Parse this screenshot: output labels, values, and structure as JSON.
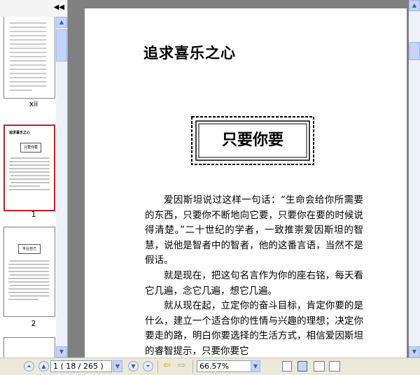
{
  "sidebar": {
    "collapse_glyph": "◀◀",
    "thumbnails": [
      {
        "label": "xii"
      },
      {
        "label": "1",
        "mini_title": "追求喜乐之心",
        "mini_box": "只要你要"
      },
      {
        "label": "2",
        "mini_box": "专业自己"
      }
    ]
  },
  "document": {
    "title": "追求喜乐之心",
    "frame_text": "只要你要",
    "paragraphs": [
      "爱因斯坦说过这样一句话：“生命会给你所需要的东西，只要你不断地向它要，只要你在要的时候说得清楚。”二十世纪的学者，一致推崇爱因斯坦的智慧，说他是智者中的智者，他的这番言语，当然不是假话。",
      "就是现在，把这句名言作为你的座右铭，每天看它几遍，念它几遍，想它几遍。",
      "就从现在起，立定你的奋斗目标，肯定你要的是什么，建立一个适合你的性情与兴趣的理想；决定你要走的路，明白你要选择的生活方式，相信爱因斯坦的睿智提示，只要你要它"
    ]
  },
  "toolbar": {
    "page_display": "1 ( 18 / 265 )",
    "zoom_display": "66.57%"
  },
  "colors": {
    "selection": "#c0202b",
    "doc_background": "#808080",
    "chrome": "#ece9d8"
  }
}
